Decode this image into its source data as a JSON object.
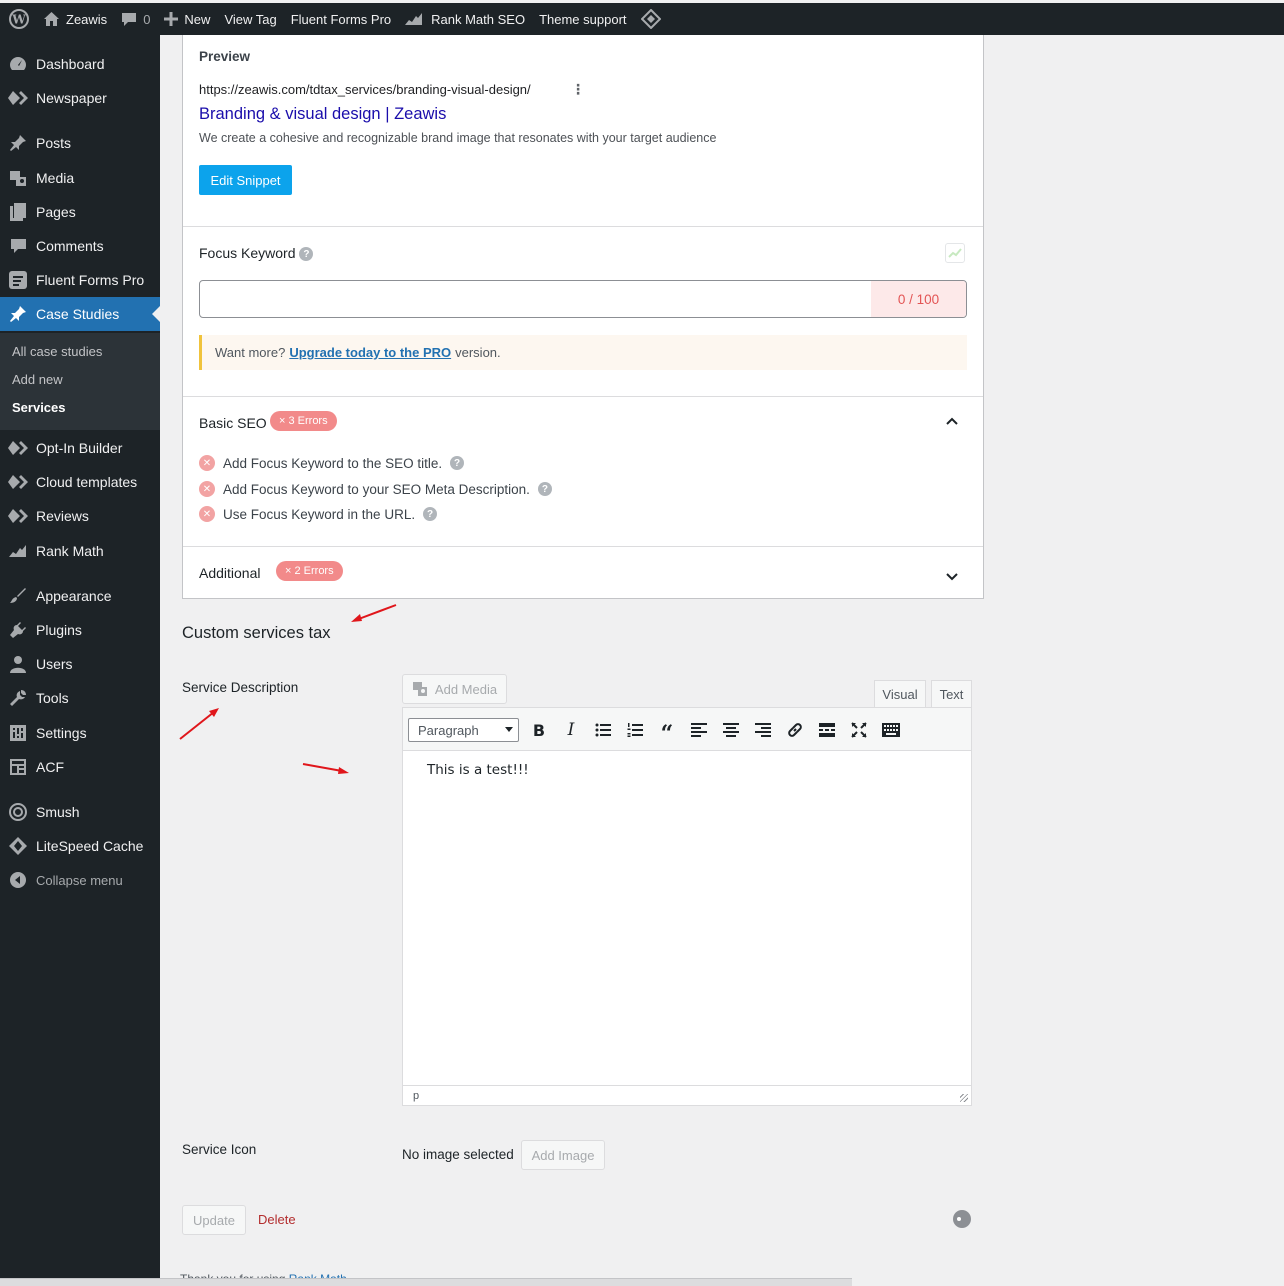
{
  "adminbar": {
    "site_name": "Zeawis",
    "comments_count": "0",
    "new_label": "New",
    "view_tag": "View Tag",
    "fluent_forms": "Fluent Forms Pro",
    "rank_math": "Rank Math SEO",
    "theme_support": "Theme support"
  },
  "sidebar": {
    "items": [
      {
        "label": "Dashboard",
        "icon": "dashboard-icon"
      },
      {
        "label": "Newspaper",
        "icon": "newspaper-icon"
      },
      {
        "label": "Posts",
        "icon": "pin-icon"
      },
      {
        "label": "Media",
        "icon": "media-icon"
      },
      {
        "label": "Pages",
        "icon": "pages-icon"
      },
      {
        "label": "Comments",
        "icon": "comment-icon"
      },
      {
        "label": "Fluent Forms Pro",
        "icon": "forms-icon"
      },
      {
        "label": "Case Studies",
        "icon": "pin-icon"
      },
      {
        "label": "Opt-In Builder",
        "icon": "diamond-icon"
      },
      {
        "label": "Cloud templates",
        "icon": "diamond-icon"
      },
      {
        "label": "Reviews",
        "icon": "diamond-icon"
      },
      {
        "label": "Rank Math",
        "icon": "chart-icon"
      },
      {
        "label": "Appearance",
        "icon": "brush-icon"
      },
      {
        "label": "Plugins",
        "icon": "plugin-icon"
      },
      {
        "label": "Users",
        "icon": "user-icon"
      },
      {
        "label": "Tools",
        "icon": "wrench-icon"
      },
      {
        "label": "Settings",
        "icon": "settings-icon"
      },
      {
        "label": "ACF",
        "icon": "acf-icon"
      },
      {
        "label": "Smush",
        "icon": "smush-icon"
      },
      {
        "label": "LiteSpeed Cache",
        "icon": "diamond-icon"
      }
    ],
    "submenu": [
      "All case studies",
      "Add new",
      "Services"
    ],
    "collapse": "Collapse menu"
  },
  "rankmath": {
    "preview_label": "Preview",
    "preview_url": "https://zeawis.com/tdtax_services/branding-visual-design/",
    "preview_title": "Branding & visual design | Zeawis",
    "preview_desc": "We create a cohesive and recognizable brand image that resonates with your target audience",
    "edit_snippet": "Edit Snippet",
    "focus_keyword_label": "Focus Keyword",
    "focus_keyword_value": "",
    "keyword_counter": "0 / 100",
    "notice_prefix": "Want more?",
    "notice_link": "Upgrade today to the PRO",
    "notice_suffix": "version.",
    "basic_seo_label": "Basic SEO",
    "basic_seo_badge": "× 3 Errors",
    "checks": [
      "Add Focus Keyword to the SEO title.",
      "Add Focus Keyword to your SEO Meta Description.",
      "Use Focus Keyword in the URL."
    ],
    "additional_label": "Additional",
    "additional_badge": "× 2 Errors"
  },
  "custom_tax": {
    "heading": "Custom services tax",
    "service_description_label": "Service Description",
    "add_media": "Add Media",
    "tab_visual": "Visual",
    "tab_text": "Text",
    "format_select": "Paragraph",
    "editor_content": "This is a test!!!",
    "status_path": "p",
    "service_icon_label": "Service Icon",
    "no_image": "No image selected",
    "add_image": "Add Image",
    "update": "Update",
    "delete": "Delete"
  },
  "footer": {
    "text": "Thank you for using",
    "link": "Rank Math"
  },
  "colors": {
    "admin_dark": "#1d2327",
    "accent_blue": "#2271b1",
    "rankmath_button": "#0ca3ec",
    "error_badge": "#f28a8a",
    "annotation_arrow": "#e0161b"
  }
}
